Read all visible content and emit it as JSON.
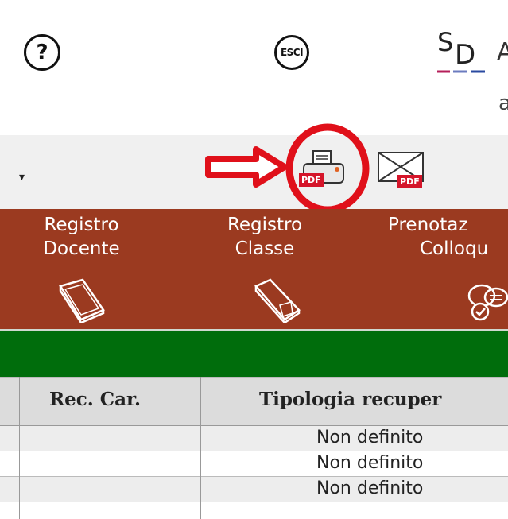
{
  "header": {
    "help_icon": "help-icon",
    "exit_label": "ESCI",
    "logo_text_s": "S",
    "logo_text_d": "D",
    "logo_right_text": "A",
    "logo_right_text2": "a"
  },
  "toolbar": {
    "dropdown_caret": "▾",
    "print_pdf_badge": "PDF",
    "mail_pdf_badge": "PDF",
    "annotation_arrow_color": "#e0101a",
    "annotation_circle_color": "#e0101a"
  },
  "nav": {
    "items": [
      {
        "line1": "Registro",
        "line2": "Docente",
        "icon": "book-icon"
      },
      {
        "line1": "Registro",
        "line2": "Classe",
        "icon": "book-icon"
      },
      {
        "line1": "Prenotaz",
        "line2": "Colloqu",
        "icon": "chat-check-icon"
      }
    ],
    "background": "#9b3a20",
    "green_bar": "#006d0c"
  },
  "table": {
    "headers": [
      "Rec. Car.",
      "Tipologia recuper"
    ],
    "rows": [
      {
        "rec": "",
        "tipologia": "Non definito"
      },
      {
        "rec": "",
        "tipologia": "Non definito"
      },
      {
        "rec": "",
        "tipologia": "Non definito"
      }
    ]
  }
}
